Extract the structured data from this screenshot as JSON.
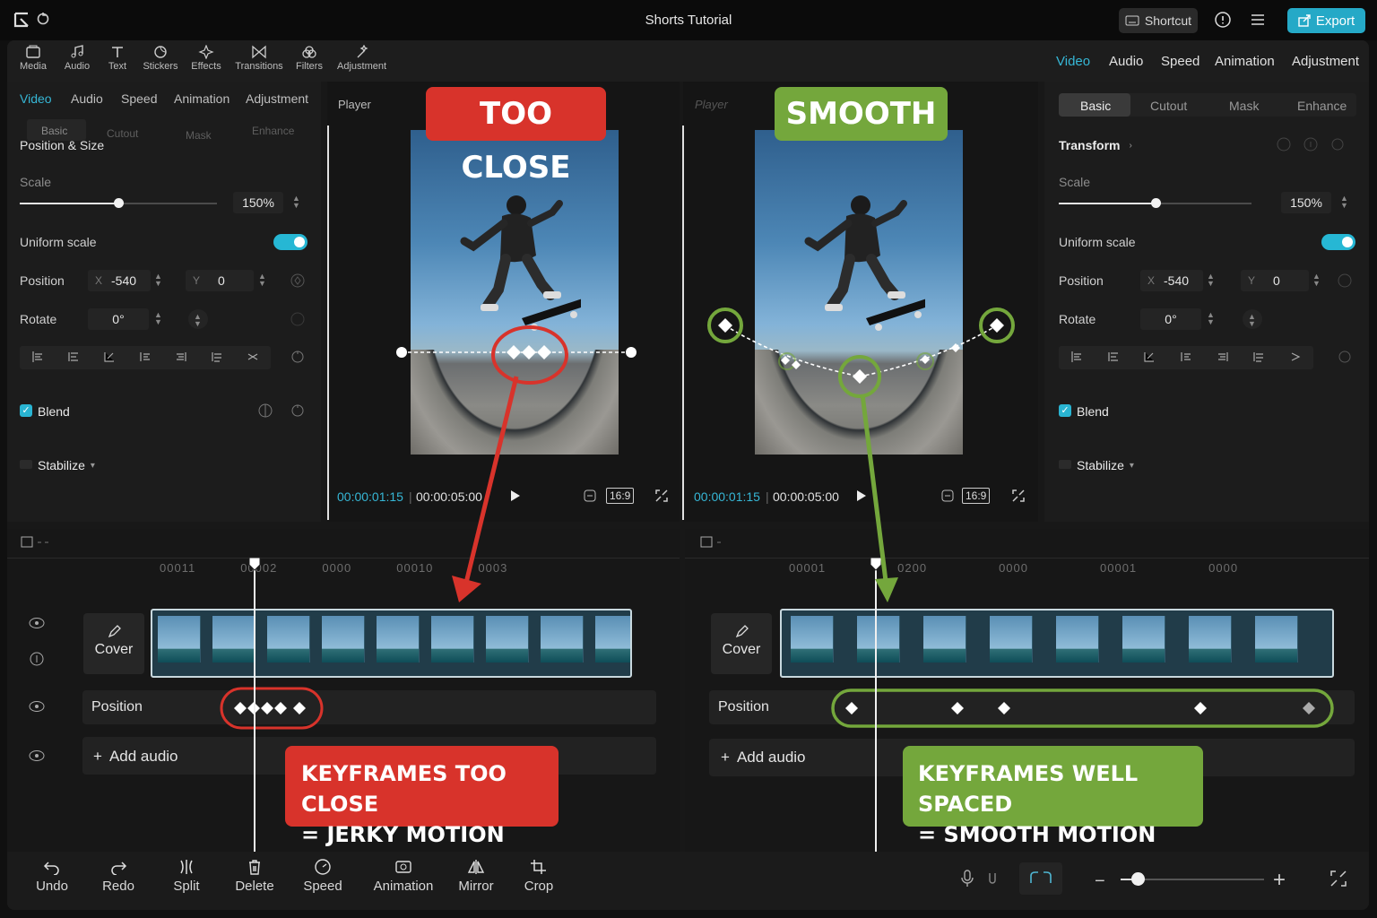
{
  "app": {
    "title": "Shorts Tutorial",
    "shortcut_label": "Shortcut",
    "export_label": "Export"
  },
  "toolbar": {
    "items": [
      "Media",
      "Audio",
      "Text",
      "Stickers",
      "Effects",
      "Transitions",
      "Filters",
      "Adjustment"
    ]
  },
  "right_tabs": {
    "items": [
      "Video",
      "Audio",
      "Speed",
      "Animation",
      "Adjustment"
    ],
    "active": "Video"
  },
  "left_panel": {
    "tabs": [
      "Video",
      "Audio",
      "Speed",
      "Animation",
      "Adjustment"
    ],
    "subtabs": [
      "Basic",
      "Cutout",
      "Mask",
      "Enhance"
    ],
    "section": "Position & Size",
    "scale_label": "Scale",
    "scale_value": "150%",
    "scale_level": 0.5,
    "uniform_label": "Uniform scale",
    "position_label": "Position",
    "pos_x_label": "X",
    "pos_x": "-540",
    "pos_y_label": "Y",
    "pos_y": "0",
    "rotate_label": "Rotate",
    "rotate_value": "0°",
    "blend_label": "Blend",
    "stabilize_label": "Stabilize"
  },
  "right_panel": {
    "subtabs": [
      "Basic",
      "Cutout",
      "Mask",
      "Enhance"
    ],
    "active_subtab": "Basic",
    "section": "Transform",
    "scale_label": "Scale",
    "scale_value": "150%",
    "scale_level": 0.5,
    "uniform_label": "Uniform scale",
    "position_label": "Position",
    "pos_x_label": "X",
    "pos_x": "-540",
    "pos_y_label": "Y",
    "pos_y": "0",
    "rotate_label": "Rotate",
    "rotate_value": "0°",
    "blend_label": "Blend",
    "stabilize_label": "Stabilize"
  },
  "player_left": {
    "label": "Player",
    "current": "00:00:01:15",
    "total": "00:00:05:00",
    "ratio": "16:9"
  },
  "player_right": {
    "label": "Player",
    "current": "00:00:01:15",
    "total": "00:00:05:00",
    "ratio": "16:9"
  },
  "timeline_left": {
    "ticks": [
      "00011",
      "00002",
      "0000",
      "00010",
      "0003"
    ],
    "cover_label": "Cover",
    "track_label": "Position",
    "add_audio_label": "Add audio"
  },
  "timeline_right": {
    "ticks": [
      "00001",
      "0200",
      "0000",
      "00001",
      "0000"
    ],
    "cover_label": "Cover",
    "track_label": "Position",
    "add_audio_label": "Add audio"
  },
  "callouts": {
    "too_close": "TOO CLOSE",
    "smooth": "SMOOTH",
    "bad_line1": "KEYFRAMES TOO CLOSE",
    "bad_line2": "= JERKY MOTION",
    "good_line1": "KEYFRAMES WELL SPACED",
    "good_line2": "= SMOOTH MOTION"
  },
  "bottom_toolbar": {
    "items": [
      "Undo",
      "Redo",
      "Split",
      "Delete",
      "Speed",
      "Animation",
      "Mirror",
      "Crop"
    ]
  },
  "colors": {
    "accent": "#26b7d4",
    "bad": "#d8332b",
    "good": "#74a73c"
  }
}
